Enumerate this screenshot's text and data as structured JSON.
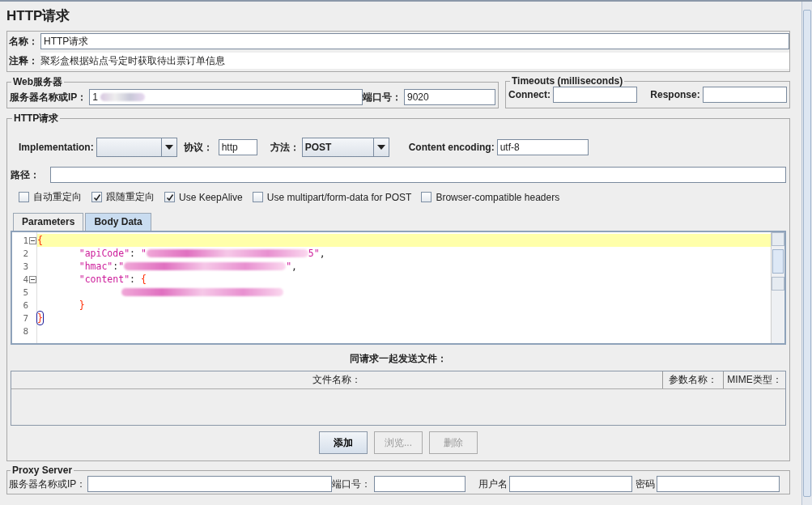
{
  "title": "HTTP请求",
  "name": {
    "label": "名称：",
    "value": "HTTP请求"
  },
  "comment": {
    "label": "注释：",
    "value": "聚彩盒根据站点号定时获取待出票订单信息"
  },
  "web_server": {
    "legend": "Web服务器",
    "server_label": "服务器名称或IP：",
    "server_value": "1",
    "server_redacted": true,
    "port_label": "端口号：",
    "port_value": "9020"
  },
  "timeouts": {
    "legend": "Timeouts (milliseconds)",
    "connect_label": "Connect:",
    "response_label": "Response:"
  },
  "http_request": {
    "legend": "HTTP请求",
    "implementation_label": "Implementation:",
    "protocol_label": "协议：",
    "protocol_value": "http",
    "method_label": "方法：",
    "method_value": "POST",
    "encoding_label": "Content encoding:",
    "encoding_value": "utf-8",
    "path_label": "路径：",
    "options": [
      {
        "label": "自动重定向",
        "checked": false
      },
      {
        "label": "跟随重定向",
        "checked": true
      },
      {
        "label": "Use KeepAlive",
        "checked": true
      },
      {
        "label": "Use multipart/form-data for POST",
        "checked": false
      },
      {
        "label": "Browser-compatible headers",
        "checked": false
      }
    ],
    "tabs": [
      {
        "label": "Parameters",
        "selected": false
      },
      {
        "label": "Body Data",
        "selected": true
      }
    ],
    "body_lines": [
      {
        "number": "1",
        "foldable": true,
        "current": true,
        "caret": false,
        "parts": [
          {
            "kind": "brace",
            "text": "{"
          }
        ]
      },
      {
        "number": "2",
        "foldable": false,
        "current": false,
        "caret": false,
        "parts": [
          {
            "kind": "string",
            "text": "\"apiCode\""
          },
          {
            "kind": "plain",
            "text": ": "
          },
          {
            "kind": "string",
            "text": "\""
          },
          {
            "kind": "redacted"
          },
          {
            "kind": "string",
            "text": "5\""
          },
          {
            "kind": "plain",
            "text": ","
          }
        ]
      },
      {
        "number": "3",
        "foldable": false,
        "current": false,
        "caret": false,
        "parts": [
          {
            "kind": "string",
            "text": "\"hmac\""
          },
          {
            "kind": "plain",
            "text": ":"
          },
          {
            "kind": "string",
            "text": "\""
          },
          {
            "kind": "redacted"
          },
          {
            "kind": "string",
            "text": "\""
          },
          {
            "kind": "plain",
            "text": ","
          }
        ]
      },
      {
        "number": "4",
        "foldable": true,
        "current": false,
        "caret": false,
        "parts": [
          {
            "kind": "string",
            "text": "\"content\""
          },
          {
            "kind": "plain",
            "text": ": "
          },
          {
            "kind": "brace",
            "text": "{"
          }
        ]
      },
      {
        "number": "5",
        "foldable": false,
        "current": false,
        "caret": false,
        "parts": [
          {
            "kind": "redacted"
          }
        ]
      },
      {
        "number": "6",
        "foldable": false,
        "current": false,
        "caret": false,
        "parts": [
          {
            "kind": "brace",
            "text": "}"
          }
        ]
      },
      {
        "number": "7",
        "foldable": false,
        "current": false,
        "caret": true,
        "parts": [
          {
            "kind": "brace",
            "text": "}"
          }
        ]
      },
      {
        "number": "8",
        "foldable": false,
        "current": false,
        "caret": false
      }
    ],
    "files_title": "同请求一起发送文件：",
    "file_columns": [
      "文件名称：",
      "参数名称：",
      "MIME类型："
    ],
    "buttons": [
      {
        "label": "添加",
        "disabled": false
      },
      {
        "label": "浏览...",
        "disabled": true
      },
      {
        "label": "删除",
        "disabled": true
      }
    ]
  },
  "proxy": {
    "legend": "Proxy Server",
    "server_label": "服务器名称或IP：",
    "port_label": "端口号：",
    "user_label": "用户名",
    "password_label": "密码"
  }
}
